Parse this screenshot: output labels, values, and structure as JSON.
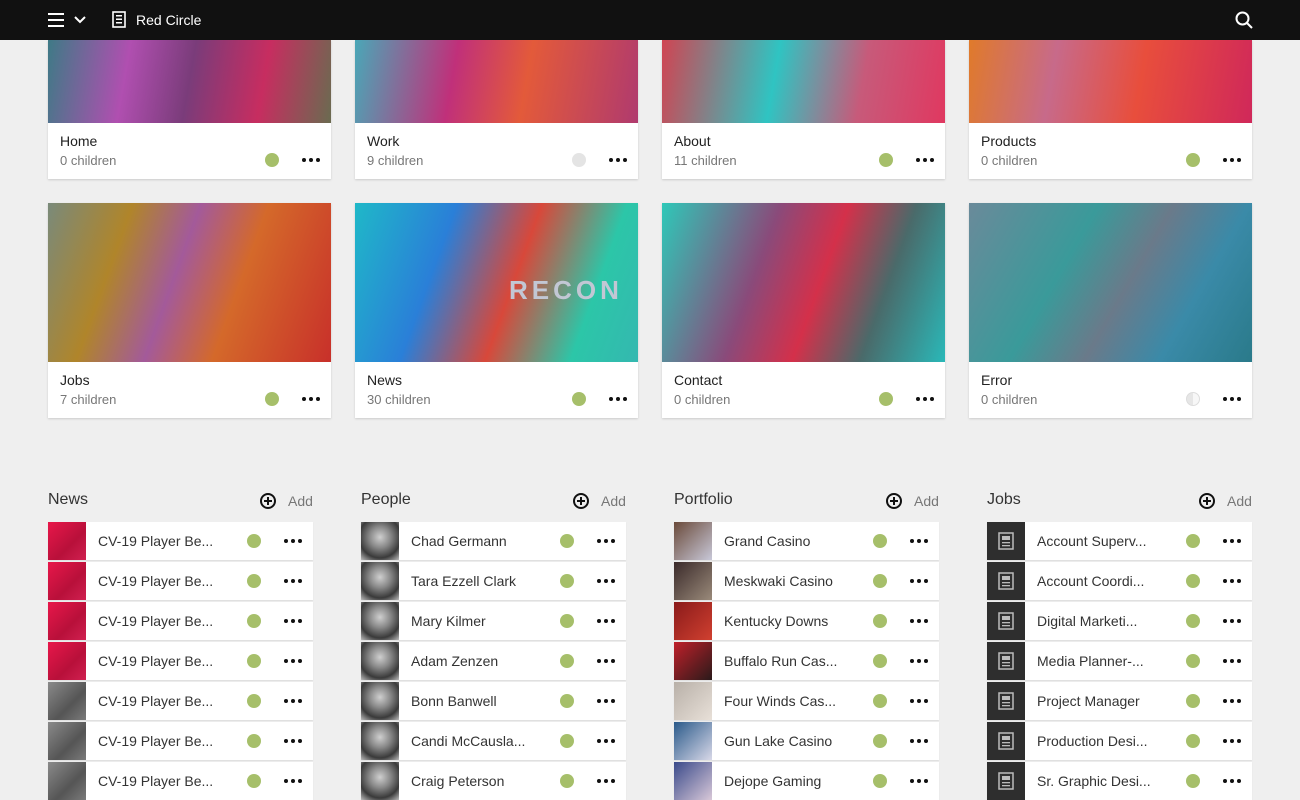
{
  "app": {
    "title": "Red Circle"
  },
  "colors": {
    "published": "#a6bf6a",
    "unpublished": "#e4e4e4",
    "partial": "#d8d8d8"
  },
  "cards": [
    {
      "name": "Home",
      "children": "0 children",
      "status": "published"
    },
    {
      "name": "Work",
      "children": "9 children",
      "status": "unpublished"
    },
    {
      "name": "About",
      "children": "11 children",
      "status": "published"
    },
    {
      "name": "Products",
      "children": "0 children",
      "status": "published"
    },
    {
      "name": "Jobs",
      "children": "7 children",
      "status": "published"
    },
    {
      "name": "News",
      "children": "30 children",
      "status": "published"
    },
    {
      "name": "Contact",
      "children": "0 children",
      "status": "published"
    },
    {
      "name": "Error",
      "children": "0 children",
      "status": "partial"
    }
  ],
  "card_overlay_text": {
    "news": "RECON"
  },
  "sections": [
    {
      "title": "News",
      "add_label": "Add",
      "items": [
        "CV-19 Player Be...",
        "CV-19 Player Be...",
        "CV-19 Player Be...",
        "CV-19 Player Be...",
        "CV-19 Player Be...",
        "CV-19 Player Be...",
        "CV-19 Player Be..."
      ]
    },
    {
      "title": "People",
      "add_label": "Add",
      "items": [
        "Chad Germann",
        "Tara Ezzell Clark",
        "Mary Kilmer",
        "Adam Zenzen",
        "Bonn Banwell",
        "Candi McCausla...",
        "Craig Peterson"
      ]
    },
    {
      "title": "Portfolio",
      "add_label": "Add",
      "items": [
        "Grand Casino",
        "Meskwaki Casino",
        "Kentucky Downs",
        "Buffalo Run Cas...",
        "Four Winds Cas...",
        "Gun Lake Casino",
        "Dejope Gaming"
      ]
    },
    {
      "title": "Jobs",
      "add_label": "Add",
      "items": [
        "Account Superv...",
        "Account Coordi...",
        "Digital Marketi...",
        "Media Planner-...",
        "Project Manager",
        "Production Desi...",
        "Sr. Graphic Desi..."
      ]
    }
  ]
}
